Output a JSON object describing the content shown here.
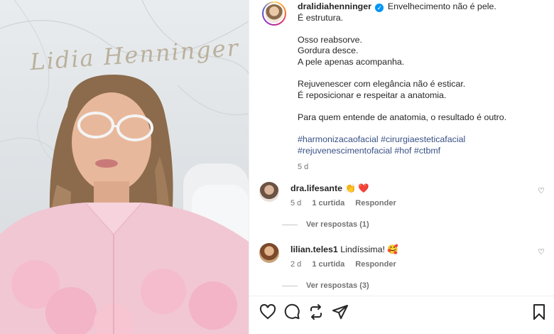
{
  "media": {
    "signature_text": "Lidia Henninger"
  },
  "post": {
    "username": "dralidiahenninger",
    "caption_lines": [
      "Envelhecimento não é pele.",
      "É estrutura.",
      "",
      "Osso reabsorve.",
      "Gordura desce.",
      "A pele apenas acompanha.",
      "",
      "Rejuvenescer com elegância não é esticar.",
      "É reposicionar e respeitar a anatomia.",
      "",
      "Para quem entende de anatomia, o resultado é outro.",
      ""
    ],
    "hashtags_line1": "#harmonizacaofacial #cirurgiaesteticafacial",
    "hashtags_line2": "#rejuvenescimentofacial #hof #ctbmf",
    "time": "5 d"
  },
  "comments": [
    {
      "username": "dra.lifesante",
      "text": "👏 ❤️",
      "time": "5 d",
      "likes": "1 curtida",
      "reply_label": "Responder",
      "view_replies": "Ver respostas (1)"
    },
    {
      "username": "lilian.teles1",
      "text": "Lindíssima! 🥰",
      "time": "2 d",
      "likes": "1 curtida",
      "reply_label": "Responder",
      "view_replies": "Ver respostas (3)"
    }
  ],
  "icons": {
    "like": "heart-icon",
    "comment": "comment-icon",
    "share": "repost-icon",
    "send": "send-icon",
    "save": "bookmark-icon",
    "verified": "verified-badge-icon"
  },
  "colors": {
    "verified": "#0095f6",
    "hashtag": "#385185",
    "muted": "#737373"
  }
}
